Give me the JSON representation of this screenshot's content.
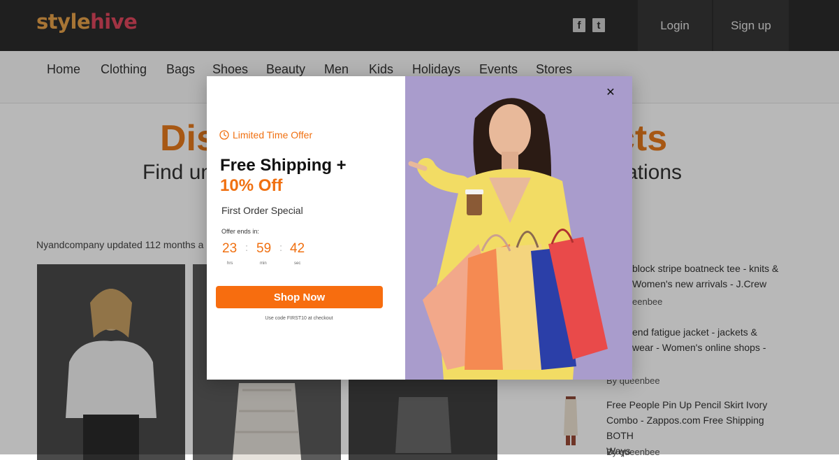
{
  "header": {
    "logo_part1": "style",
    "logo_part2": "hive",
    "facebook_glyph": "f",
    "twitter_glyph": "t",
    "login_label": "Login",
    "signup_label": "Sign up"
  },
  "nav": {
    "items": [
      "Home",
      "Clothing",
      "Bags",
      "Shoes",
      "Beauty",
      "Men",
      "Kids",
      "Holidays",
      "Events",
      "Stores"
    ]
  },
  "page": {
    "hero_left": "Dis",
    "hero_right": "cts",
    "hero_sub_left": "Find un",
    "hero_sub_right": "ations",
    "updated_text": "Nyandcompany updated 112 months a",
    "side_items": [
      {
        "line1": "block stripe boatneck tee - knits &",
        "line2": "Women's new arrivals - J.Crew",
        "by": "eenbee"
      },
      {
        "line1": "end fatigue jacket - jackets &",
        "line2": "wear - Women's online shops -",
        "line3": "",
        "by": "By  queenbee"
      },
      {
        "line1": "Free People Pin Up Pencil Skirt Ivory",
        "line2": "Combo - Zappos.com Free Shipping BOTH",
        "line3": "Ways",
        "by": "By  queenbee"
      }
    ]
  },
  "modal": {
    "badge": "Limited Time Offer",
    "headline_line1": "Free Shipping +",
    "headline_line2": "10% Off",
    "subheadline": "First Order Special",
    "offer_ends_label": "Offer ends in:",
    "countdown": {
      "hours": "23",
      "hours_label": "hrs",
      "minutes": "59",
      "minutes_label": "min",
      "seconds": "42",
      "seconds_label": "sec",
      "separator": ":"
    },
    "cta_label": "Shop Now",
    "code_note": "Use code FIRST10 at checkout",
    "close_glyph": "✕"
  },
  "icons": {
    "clock": "clock-icon",
    "close": "close-icon",
    "facebook": "facebook-icon",
    "twitter": "twitter-icon"
  },
  "colors": {
    "accent": "#f07011",
    "button": "#f76d0f",
    "header_bg": "#2c2c2c",
    "modal_image_bg": "#a99ccc"
  }
}
